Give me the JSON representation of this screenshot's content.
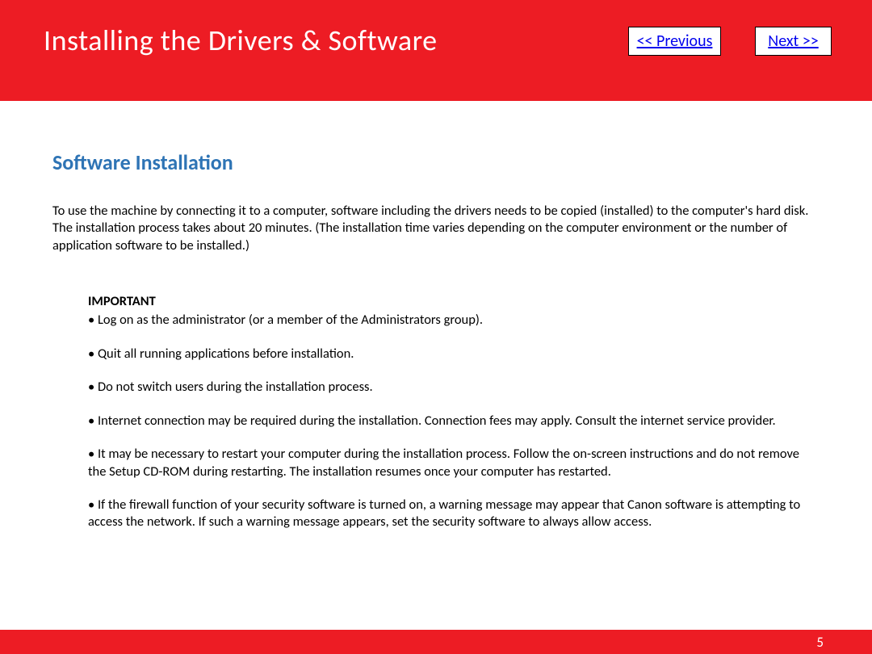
{
  "header": {
    "title": "Installing  the Drivers & Software",
    "prev_label": " << Previous",
    "next_label": "Next >>"
  },
  "content": {
    "section_title": "Software Installation",
    "intro": "To use the machine by connecting it to a computer, software including the drivers needs to be copied (installed) to the computer's hard disk. The installation process takes about 20 minutes. (The installation time varies depending on the computer environment or the number of application software to be installed.)",
    "important_label": "IMPORTANT",
    "notes": [
      "• Log on as the administrator (or a member of the Administrators group).",
      "• Quit all running applications before installation.",
      "• Do not switch users during the installation process.",
      "• Internet connection may be required during the installation. Connection fees may apply. Consult the internet service provider.",
      "• It may be necessary to restart your computer during the installation process. Follow the on-screen instructions and do not remove the Setup CD-ROM during restarting. The installation resumes once your computer has restarted.",
      "• If the firewall function of your security software is turned on, a warning message may appear that Canon software is attempting to access the network. If such a warning message appears, set the security software to always allow access."
    ]
  },
  "footer": {
    "page_number": "5"
  }
}
